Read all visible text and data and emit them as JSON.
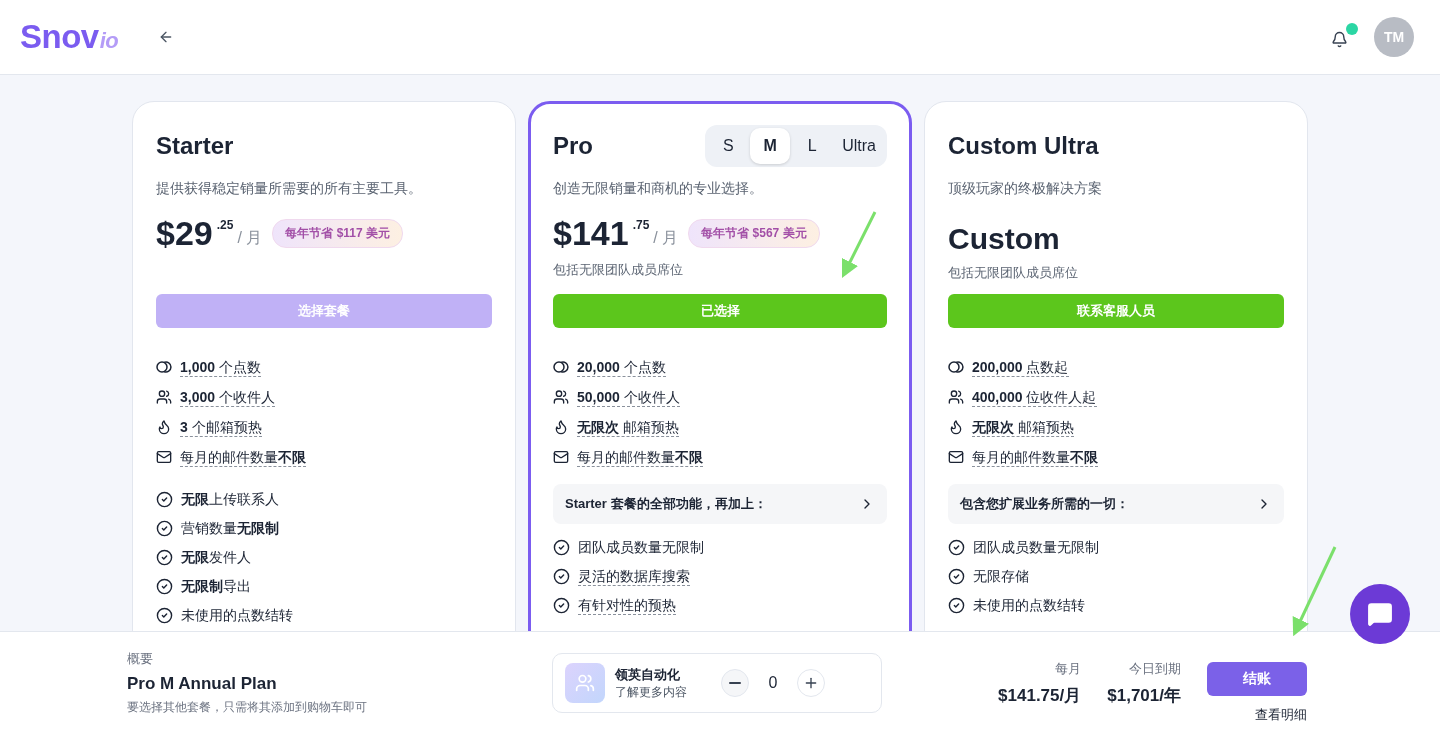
{
  "header": {
    "logo": {
      "main": "Snov",
      "suffix": "io"
    },
    "notifications": {
      "unread": true
    },
    "avatar": "TM"
  },
  "plans": [
    {
      "name": "Starter",
      "selected": false,
      "description": "提供获得稳定销量所需要的所有主要工具。",
      "price": {
        "kind": "amount",
        "main": "$29",
        "cents": ".25",
        "period": "/ 月"
      },
      "badge": "每年节省 $117 美元",
      "button": {
        "label": "选择套餐",
        "kind": "select"
      },
      "usage": [
        {
          "text": "**1,000** 个点数",
          "dotted": true
        },
        {
          "text": "**3,000** 个收件人",
          "dotted": true
        },
        {
          "text": "**3** 个邮箱预热",
          "dotted": true
        },
        {
          "text": "每月的邮件数量**不限**",
          "dotted": true
        }
      ],
      "features": [
        {
          "text": "**无限**上传联系人",
          "dotted": false
        },
        {
          "text": "营销数量**无限制**",
          "dotted": false
        },
        {
          "text": "**无限**发件人",
          "dotted": false
        },
        {
          "text": "**无限制**导出",
          "dotted": false
        },
        {
          "text": "未使用的点数结转",
          "dotted": false
        }
      ]
    },
    {
      "name": "Pro",
      "selected": true,
      "sizes": [
        {
          "label": "S",
          "selected": false
        },
        {
          "label": "M",
          "selected": true
        },
        {
          "label": "L",
          "selected": false
        },
        {
          "label": "Ultra",
          "selected": false
        }
      ],
      "description": "创造无限销量和商机的专业选择。",
      "price": {
        "kind": "amount",
        "main": "$141",
        "cents": ".75",
        "period": "/ 月"
      },
      "badge": "每年节省 $567 美元",
      "seats": "包括无限团队成员席位",
      "button": {
        "label": "已选择",
        "kind": "selected"
      },
      "usage": [
        {
          "text": "**20,000** 个点数",
          "dotted": true
        },
        {
          "text": "**50,000** 个收件人",
          "dotted": true
        },
        {
          "text": "**无限次** 邮箱预热",
          "dotted": true
        },
        {
          "text": "每月的邮件数量**不限**",
          "dotted": true
        }
      ],
      "section": "Starter 套餐的全部功能，再加上：",
      "features": [
        {
          "text": "团队成员数量无限制",
          "dotted": false
        },
        {
          "text": "灵活的数据库搜索",
          "dotted": true
        },
        {
          "text": "有针对性的预热",
          "dotted": true
        }
      ]
    },
    {
      "name": "Custom Ultra",
      "selected": false,
      "description": "顶级玩家的终极解决方案",
      "price": {
        "kind": "custom",
        "main": "Custom"
      },
      "seats": "包括无限团队成员席位",
      "button": {
        "label": "联系客服人员",
        "kind": "contact"
      },
      "usage": [
        {
          "text": "**200,000** 点数起",
          "dotted": true
        },
        {
          "text": "**400,000** 位收件人起",
          "dotted": true
        },
        {
          "text": "**无限次** 邮箱预热",
          "dotted": true
        },
        {
          "text": "每月的邮件数量**不限**",
          "dotted": true
        }
      ],
      "section": "包含您扩展业务所需的一切：",
      "features": [
        {
          "text": "团队成员数量无限制",
          "dotted": false
        },
        {
          "text": "无限存储",
          "dotted": false
        },
        {
          "text": "未使用的点数结转",
          "dotted": false
        }
      ]
    }
  ],
  "summary": {
    "label": "概要",
    "plan": "Pro M Annual Plan",
    "hint": "要选择其他套餐，只需将其添加到购物车即可",
    "addon": {
      "title": "领英自动化",
      "link": "了解更多内容",
      "quantity": "0"
    },
    "totals": [
      {
        "label": "每月",
        "value": "$141.75/月"
      },
      {
        "label": "今日到期",
        "value": "$1,701/年"
      }
    ],
    "checkout": "结账",
    "details": "查看明细"
  }
}
